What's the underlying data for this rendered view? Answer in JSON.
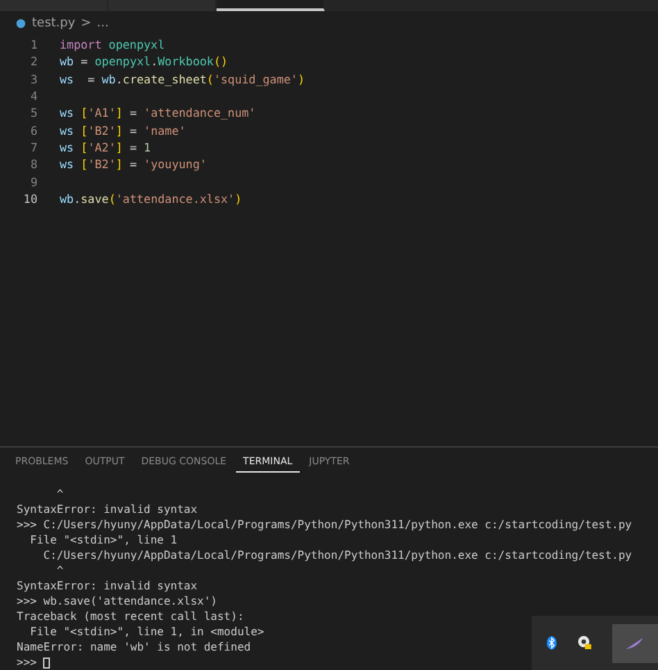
{
  "editor_tabs": [
    {
      "selected": false
    },
    {
      "selected": false
    },
    {
      "selected": true
    }
  ],
  "breadcrumb": {
    "file": "test.py",
    "separator": ">",
    "rest": "..."
  },
  "code_lines": [
    {
      "number": "1",
      "current": false,
      "tokens": [
        {
          "text": "import ",
          "kind": "keyword"
        },
        {
          "text": "openpyxl",
          "kind": "module"
        }
      ]
    },
    {
      "number": "2",
      "current": false,
      "tokens": [
        {
          "text": "wb",
          "kind": "variable"
        },
        {
          "text": " = ",
          "kind": "plain"
        },
        {
          "text": "openpyxl",
          "kind": "module"
        },
        {
          "text": ".",
          "kind": "plain"
        },
        {
          "text": "Workbook",
          "kind": "module"
        },
        {
          "text": "()",
          "kind": "bracket"
        }
      ]
    },
    {
      "number": "3",
      "current": false,
      "tokens": [
        {
          "text": "ws",
          "kind": "variable"
        },
        {
          "text": "  = ",
          "kind": "plain"
        },
        {
          "text": "wb",
          "kind": "variable"
        },
        {
          "text": ".",
          "kind": "plain"
        },
        {
          "text": "create_sheet",
          "kind": "function"
        },
        {
          "text": "(",
          "kind": "bracket"
        },
        {
          "text": "'squid_game'",
          "kind": "string"
        },
        {
          "text": ")",
          "kind": "bracket"
        }
      ]
    },
    {
      "number": "4",
      "current": false
    },
    {
      "number": "5",
      "current": false,
      "tokens": [
        {
          "text": "ws ",
          "kind": "variable"
        },
        {
          "text": "[",
          "kind": "bracket"
        },
        {
          "text": "'A1'",
          "kind": "string"
        },
        {
          "text": "]",
          "kind": "bracket"
        },
        {
          "text": " = ",
          "kind": "plain"
        },
        {
          "text": "'attendance_num'",
          "kind": "string"
        }
      ]
    },
    {
      "number": "6",
      "current": false,
      "tokens": [
        {
          "text": "ws ",
          "kind": "variable"
        },
        {
          "text": "[",
          "kind": "bracket"
        },
        {
          "text": "'B2'",
          "kind": "string"
        },
        {
          "text": "]",
          "kind": "bracket"
        },
        {
          "text": " = ",
          "kind": "plain"
        },
        {
          "text": "'name'",
          "kind": "string"
        }
      ]
    },
    {
      "number": "7",
      "current": false,
      "tokens": [
        {
          "text": "ws ",
          "kind": "variable"
        },
        {
          "text": "[",
          "kind": "bracket"
        },
        {
          "text": "'A2'",
          "kind": "string"
        },
        {
          "text": "]",
          "kind": "bracket"
        },
        {
          "text": " = ",
          "kind": "plain"
        },
        {
          "text": "1",
          "kind": "number"
        }
      ]
    },
    {
      "number": "8",
      "current": false,
      "tokens": [
        {
          "text": "ws ",
          "kind": "variable"
        },
        {
          "text": "[",
          "kind": "bracket"
        },
        {
          "text": "'B2'",
          "kind": "string"
        },
        {
          "text": "]",
          "kind": "bracket"
        },
        {
          "text": " = ",
          "kind": "plain"
        },
        {
          "text": "'youyung'",
          "kind": "string"
        }
      ]
    },
    {
      "number": "9",
      "current": false
    },
    {
      "number": "10",
      "current": true,
      "tokens": [
        {
          "text": "wb",
          "kind": "variable"
        },
        {
          "text": ".",
          "kind": "plain"
        },
        {
          "text": "save",
          "kind": "function"
        },
        {
          "text": "(",
          "kind": "bracket"
        },
        {
          "text": "'attendance.xlsx'",
          "kind": "string"
        },
        {
          "text": ")",
          "kind": "bracket"
        }
      ]
    }
  ],
  "panel_tabs": [
    {
      "label": "PROBLEMS",
      "selected": false
    },
    {
      "label": "OUTPUT",
      "selected": false
    },
    {
      "label": "DEBUG CONSOLE",
      "selected": false
    },
    {
      "label": "TERMINAL",
      "selected": true
    },
    {
      "label": "JUPYTER",
      "selected": false
    }
  ],
  "terminal_lines": [
    "      ^",
    "SyntaxError: invalid syntax",
    ">>> C:/Users/hyuny/AppData/Local/Programs/Python/Python311/python.exe c:/startcoding/test.py",
    "  File \"<stdin>\", line 1",
    "    C:/Users/hyuny/AppData/Local/Programs/Python/Python311/python.exe c:/startcoding/test.py",
    "      ^",
    "SyntaxError: invalid syntax",
    ">>> wb.save('attendance.xlsx')",
    "Traceback (most recent call last):",
    "  File \"<stdin>\", line 1, in <module>",
    "NameError: name 'wb' is not defined"
  ],
  "terminal_prompt": ">>> "
}
